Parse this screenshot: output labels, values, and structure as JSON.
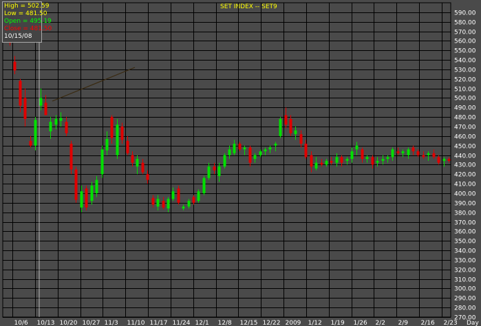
{
  "chart_data": {
    "type": "candlestick",
    "title": "SET INDEX -- SET9",
    "ylim": [
      270,
      600
    ],
    "y_ticks": [
      270,
      280,
      290,
      300,
      310,
      320,
      330,
      340,
      350,
      360,
      370,
      380,
      390,
      400,
      410,
      420,
      430,
      440,
      450,
      460,
      470,
      480,
      490,
      500,
      510,
      520,
      530,
      540,
      550,
      560,
      570,
      580,
      590
    ],
    "x_tick_labels": [
      "10/6",
      "10/13",
      "10/20",
      "10/27",
      "11/3",
      "11/10",
      "11/17",
      "11/24",
      "12/1",
      "12/8",
      "12/15",
      "12/22",
      "2009",
      "1/12",
      "1/19",
      "1/26",
      "2/2",
      "2/9",
      "2/16",
      "2/23"
    ],
    "x_axis_unit": "Day",
    "ohlc_panel": {
      "high_label": "High",
      "high_value": "502.59",
      "low_label": "Low",
      "low_value": "481.50",
      "open_label": "Open",
      "open_value": "495.19",
      "close_label": "Close",
      "close_value": "481.50",
      "date": "10/15/08"
    },
    "candles": [
      {
        "o": 565,
        "h": 568,
        "l": 555,
        "c": 558
      },
      {
        "o": 538,
        "h": 544,
        "l": 525,
        "c": 529
      },
      {
        "o": 518,
        "h": 520,
        "l": 485,
        "c": 492
      },
      {
        "o": 500,
        "h": 510,
        "l": 470,
        "c": 478
      },
      {
        "o": 455,
        "h": 460,
        "l": 448,
        "c": 450
      },
      {
        "o": 450,
        "h": 480,
        "l": 445,
        "c": 477
      },
      {
        "o": 492,
        "h": 510,
        "l": 487,
        "c": 500
      },
      {
        "o": 495,
        "h": 503,
        "l": 482,
        "c": 482
      },
      {
        "o": 465,
        "h": 480,
        "l": 457,
        "c": 475
      },
      {
        "o": 472,
        "h": 482,
        "l": 467,
        "c": 478
      },
      {
        "o": 476,
        "h": 485,
        "l": 470,
        "c": 479
      },
      {
        "o": 475,
        "h": 480,
        "l": 460,
        "c": 463
      },
      {
        "o": 452,
        "h": 455,
        "l": 420,
        "c": 425
      },
      {
        "o": 425,
        "h": 428,
        "l": 390,
        "c": 393
      },
      {
        "o": 385,
        "h": 408,
        "l": 380,
        "c": 402
      },
      {
        "o": 405,
        "h": 408,
        "l": 382,
        "c": 385
      },
      {
        "o": 392,
        "h": 412,
        "l": 388,
        "c": 408
      },
      {
        "o": 400,
        "h": 418,
        "l": 396,
        "c": 414
      },
      {
        "o": 420,
        "h": 450,
        "l": 416,
        "c": 446
      },
      {
        "o": 445,
        "h": 465,
        "l": 440,
        "c": 457
      },
      {
        "o": 480,
        "h": 482,
        "l": 452,
        "c": 458
      },
      {
        "o": 440,
        "h": 478,
        "l": 436,
        "c": 472
      },
      {
        "o": 470,
        "h": 474,
        "l": 452,
        "c": 456
      },
      {
        "o": 455,
        "h": 460,
        "l": 440,
        "c": 442
      },
      {
        "o": 440,
        "h": 444,
        "l": 428,
        "c": 432
      },
      {
        "o": 428,
        "h": 440,
        "l": 420,
        "c": 436
      },
      {
        "o": 432,
        "h": 436,
        "l": 420,
        "c": 422
      },
      {
        "o": 420,
        "h": 424,
        "l": 410,
        "c": 414
      },
      {
        "o": 395,
        "h": 398,
        "l": 385,
        "c": 388
      },
      {
        "o": 386,
        "h": 398,
        "l": 382,
        "c": 394
      },
      {
        "o": 392,
        "h": 396,
        "l": 383,
        "c": 385
      },
      {
        "o": 384,
        "h": 396,
        "l": 380,
        "c": 394
      },
      {
        "o": 394,
        "h": 406,
        "l": 392,
        "c": 402
      },
      {
        "o": 405,
        "h": 408,
        "l": 388,
        "c": 390
      },
      {
        "o": 384,
        "h": 388,
        "l": 382,
        "c": 386
      },
      {
        "o": 386,
        "h": 394,
        "l": 384,
        "c": 392
      },
      {
        "o": 396,
        "h": 398,
        "l": 388,
        "c": 390
      },
      {
        "o": 392,
        "h": 404,
        "l": 390,
        "c": 402
      },
      {
        "o": 400,
        "h": 418,
        "l": 398,
        "c": 416
      },
      {
        "o": 416,
        "h": 432,
        "l": 414,
        "c": 428
      },
      {
        "o": 428,
        "h": 432,
        "l": 420,
        "c": 424
      },
      {
        "o": 418,
        "h": 432,
        "l": 412,
        "c": 428
      },
      {
        "o": 428,
        "h": 442,
        "l": 426,
        "c": 440
      },
      {
        "o": 440,
        "h": 450,
        "l": 436,
        "c": 446
      },
      {
        "o": 442,
        "h": 456,
        "l": 440,
        "c": 452
      },
      {
        "o": 452,
        "h": 454,
        "l": 444,
        "c": 446
      },
      {
        "o": 446,
        "h": 450,
        "l": 440,
        "c": 448
      },
      {
        "o": 448,
        "h": 450,
        "l": 428,
        "c": 432
      },
      {
        "o": 436,
        "h": 442,
        "l": 432,
        "c": 440
      },
      {
        "o": 440,
        "h": 446,
        "l": 438,
        "c": 444
      },
      {
        "o": 444,
        "h": 448,
        "l": 440,
        "c": 446
      },
      {
        "o": 446,
        "h": 450,
        "l": 442,
        "c": 448
      },
      {
        "o": 450,
        "h": 454,
        "l": 444,
        "c": 452
      },
      {
        "o": 460,
        "h": 480,
        "l": 458,
        "c": 478
      },
      {
        "o": 482,
        "h": 490,
        "l": 468,
        "c": 472
      },
      {
        "o": 478,
        "h": 482,
        "l": 460,
        "c": 463
      },
      {
        "o": 462,
        "h": 470,
        "l": 456,
        "c": 466
      },
      {
        "o": 462,
        "h": 466,
        "l": 448,
        "c": 452
      },
      {
        "o": 452,
        "h": 456,
        "l": 436,
        "c": 438
      },
      {
        "o": 440,
        "h": 444,
        "l": 422,
        "c": 428
      },
      {
        "o": 426,
        "h": 438,
        "l": 424,
        "c": 432
      },
      {
        "o": 432,
        "h": 436,
        "l": 428,
        "c": 430
      },
      {
        "o": 430,
        "h": 436,
        "l": 428,
        "c": 434
      },
      {
        "o": 434,
        "h": 438,
        "l": 430,
        "c": 432
      },
      {
        "o": 432,
        "h": 442,
        "l": 428,
        "c": 438
      },
      {
        "o": 438,
        "h": 440,
        "l": 428,
        "c": 432
      },
      {
        "o": 434,
        "h": 438,
        "l": 430,
        "c": 436
      },
      {
        "o": 436,
        "h": 448,
        "l": 432,
        "c": 444
      },
      {
        "o": 446,
        "h": 454,
        "l": 440,
        "c": 450
      },
      {
        "o": 446,
        "h": 448,
        "l": 432,
        "c": 436
      },
      {
        "o": 436,
        "h": 440,
        "l": 432,
        "c": 438
      },
      {
        "o": 438,
        "h": 440,
        "l": 426,
        "c": 430
      },
      {
        "o": 432,
        "h": 438,
        "l": 428,
        "c": 434
      },
      {
        "o": 434,
        "h": 440,
        "l": 430,
        "c": 436
      },
      {
        "o": 436,
        "h": 440,
        "l": 432,
        "c": 438
      },
      {
        "o": 438,
        "h": 448,
        "l": 434,
        "c": 446
      },
      {
        "o": 444,
        "h": 448,
        "l": 440,
        "c": 442
      },
      {
        "o": 442,
        "h": 446,
        "l": 438,
        "c": 444
      },
      {
        "o": 440,
        "h": 448,
        "l": 436,
        "c": 446
      },
      {
        "o": 448,
        "h": 450,
        "l": 440,
        "c": 444
      },
      {
        "o": 444,
        "h": 446,
        "l": 438,
        "c": 440
      },
      {
        "o": 440,
        "h": 444,
        "l": 436,
        "c": 438
      },
      {
        "o": 440,
        "h": 444,
        "l": 434,
        "c": 442
      },
      {
        "o": 442,
        "h": 446,
        "l": 436,
        "c": 438
      },
      {
        "o": 438,
        "h": 440,
        "l": 430,
        "c": 432
      },
      {
        "o": 434,
        "h": 438,
        "l": 428,
        "c": 436
      },
      {
        "o": 436,
        "h": 438,
        "l": 432,
        "c": 434
      }
    ],
    "colors": {
      "background": "#4a4a4a",
      "grid": "#000000",
      "up": "#00e000",
      "down": "#e00000",
      "axis_text": "#ffffff",
      "title": "#ffff00",
      "high_low_label": "#ffff00",
      "open_label": "#00ff00",
      "close_label": "#ff0000",
      "trend_line": "#3a2a10"
    }
  }
}
